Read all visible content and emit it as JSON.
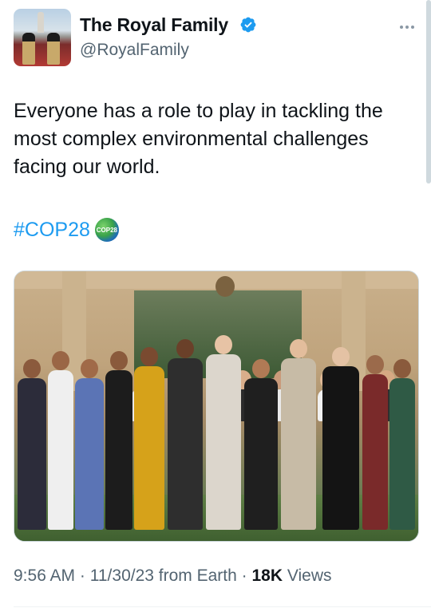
{
  "tweet": {
    "author": {
      "display_name": "The Royal Family",
      "handle": "@RoyalFamily",
      "verified_icon": "verified-badge-icon",
      "verified_color": "#1d9bf0"
    },
    "text": "Everyone has a role to play in tackling the most complex environmental challenges facing our world.",
    "hashtag": "#COP28",
    "hashtag_emoji_text": "COP28",
    "link_color": "#1d9bf0"
  },
  "footer": {
    "time": "9:56 AM",
    "sep1": "·",
    "date": "11/30/23",
    "source": "from Earth",
    "sep2": "·",
    "views_count": "18K",
    "views_label": "Views"
  },
  "more_icon": "more-options-icon"
}
